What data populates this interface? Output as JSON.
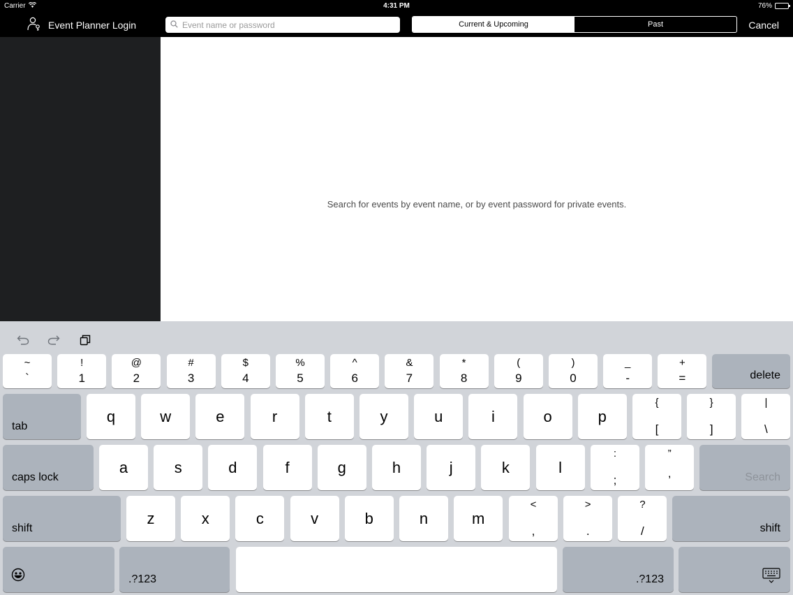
{
  "status_bar": {
    "carrier": "Carrier",
    "time": "4:31 PM",
    "battery": "76%",
    "battery_level": 0.76
  },
  "nav": {
    "title": "Event Planner Login",
    "search_placeholder": "Event name or password",
    "segments": [
      "Current & Upcoming",
      "Past"
    ],
    "active_segment": 0,
    "cancel": "Cancel"
  },
  "main": {
    "hint": "Search for events by event name, or by event password for private events."
  },
  "keyboard": {
    "row1": [
      {
        "top": "~",
        "bot": "`"
      },
      {
        "top": "!",
        "bot": "1"
      },
      {
        "top": "@",
        "bot": "2"
      },
      {
        "top": "#",
        "bot": "3"
      },
      {
        "top": "$",
        "bot": "4"
      },
      {
        "top": "%",
        "bot": "5"
      },
      {
        "top": "^",
        "bot": "6"
      },
      {
        "top": "&",
        "bot": "7"
      },
      {
        "top": "*",
        "bot": "8"
      },
      {
        "top": "(",
        "bot": "9"
      },
      {
        "top": ")",
        "bot": "0"
      },
      {
        "top": "_",
        "bot": "-"
      },
      {
        "top": "+",
        "bot": "="
      }
    ],
    "delete": "delete",
    "tab": "tab",
    "row2_letters": [
      "q",
      "w",
      "e",
      "r",
      "t",
      "y",
      "u",
      "i",
      "o",
      "p"
    ],
    "row2_symbols": [
      {
        "top": "{",
        "bot": "["
      },
      {
        "top": "}",
        "bot": "]"
      },
      {
        "top": "|",
        "bot": "\\"
      }
    ],
    "caps_lock": "caps lock",
    "row3_letters": [
      "a",
      "s",
      "d",
      "f",
      "g",
      "h",
      "j",
      "k",
      "l"
    ],
    "row3_symbols": [
      {
        "top": ":",
        "bot": ";"
      },
      {
        "top": "”",
        "bot": "’"
      }
    ],
    "search": "Search",
    "shift": "shift",
    "row4_letters": [
      "z",
      "x",
      "c",
      "v",
      "b",
      "n",
      "m"
    ],
    "row4_symbols": [
      {
        "top": "<",
        "bot": ","
      },
      {
        "top": ">",
        "bot": "."
      },
      {
        "top": "?",
        "bot": "/"
      }
    ],
    "numbers_key": ".?123"
  }
}
